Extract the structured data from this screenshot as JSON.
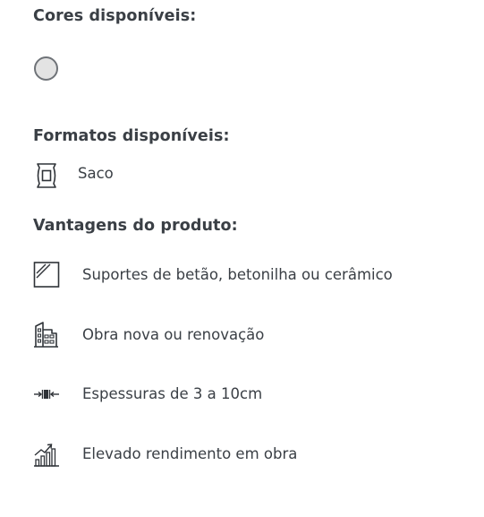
{
  "colors": {
    "title": "Cores disponíveis:",
    "swatches": [
      {
        "color": "#e3e3e3"
      }
    ]
  },
  "formats": {
    "title": "Formatos disponíveis:",
    "items": [
      {
        "icon": "bag-icon",
        "label": "Saco"
      }
    ]
  },
  "advantages": {
    "title": "Vantagens do produto:",
    "items": [
      {
        "icon": "surface-icon",
        "label": "Suportes de betão, betonilha ou cerâmico"
      },
      {
        "icon": "building-icon",
        "label": "Obra nova ou renovação"
      },
      {
        "icon": "thickness-icon",
        "label": "Espessuras de 3 a 10cm"
      },
      {
        "icon": "growth-chart-icon",
        "label": "Elevado rendimento em obra"
      }
    ]
  }
}
